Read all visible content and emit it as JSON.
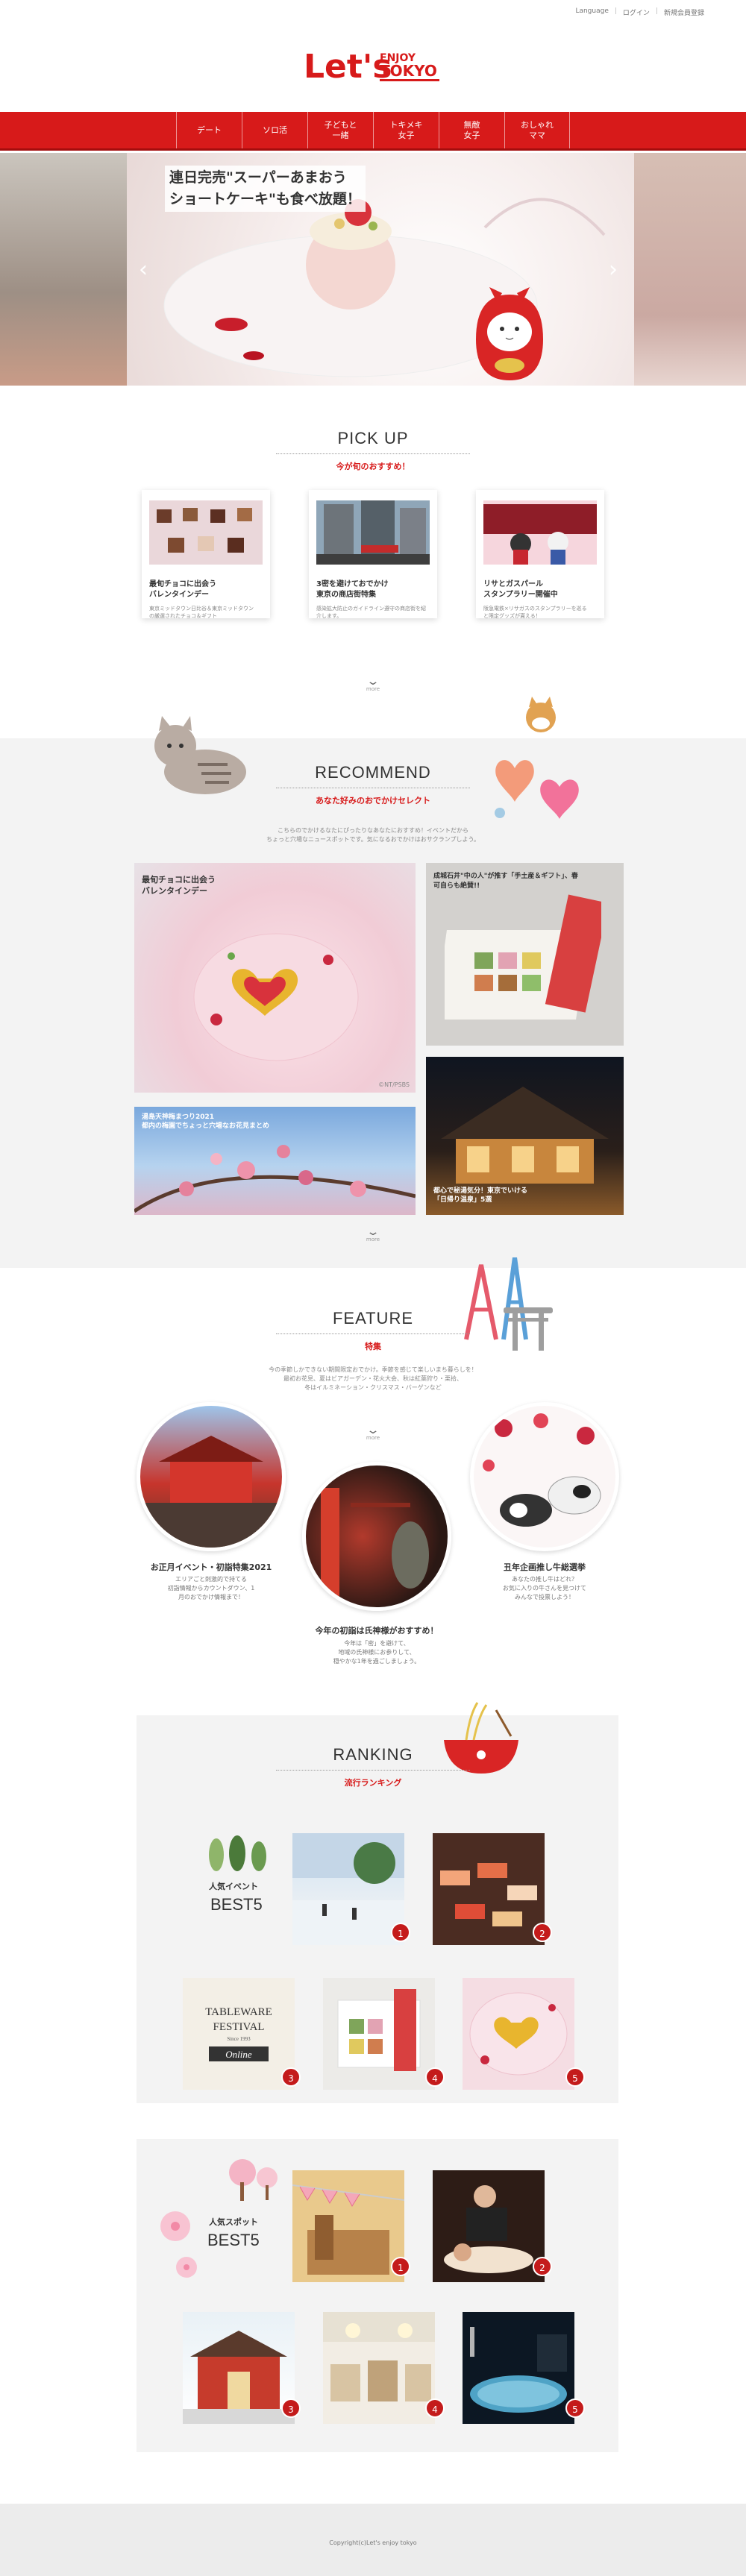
{
  "header": {
    "links": [
      "Language",
      "ログイン",
      "新規会員登録"
    ],
    "logo_main": "Let's",
    "logo_sub1": "ENJOY",
    "logo_sub2": "TOKYO"
  },
  "nav": {
    "items": [
      "デート",
      "ソロ活",
      "子どもと\n一緒",
      "トキメキ\n女子",
      "無敵\n女子",
      "おしゃれ\nママ"
    ]
  },
  "hero": {
    "caption_line1": "連日完売\"スーパーあまおう",
    "caption_line2": "ショートケーキ\"も食べ放題！",
    "prev": "‹",
    "next": "›"
  },
  "pickup": {
    "title_en": "PICK UP",
    "title_jp": "今が旬のおすすめ！",
    "cards": [
      {
        "title": "最旬チョコに出会う\nバレンタインデー",
        "desc": "東京ミッドタウン日比谷＆東京ミッドタウン\nの厳選されたチョコ＆ギフト"
      },
      {
        "title": "3密を避けておでかけ\n東京の商店街特集",
        "desc": "感染拡大防止のガイドライン遵守の商店街を紹\n介します。"
      },
      {
        "title": "リサとガスパール\nスタンプラリー開催中",
        "desc": "阪急電鉄×リサガスのスタンプラリーを巡る\nと限定グッズが貰える！"
      }
    ],
    "more": "more"
  },
  "recommend": {
    "title_en": "RECOMMEND",
    "title_jp": "あなた好みのおでかけセレクト",
    "intro_line1": "こちらのでかけるなたにぴったりなあなたにおすすめ！イベントだから",
    "intro_line2": "ちょっと穴場なニュースポットです。気になるおでかけはおサクランプしよう。",
    "tiles": [
      {
        "caption": "最旬チョコに出会う\nバレンタインデー",
        "credit": "©NT/PSBS"
      },
      {
        "caption": "成城石井\"中の人\"が推す「手土産＆ギフト」、春\n可自らも絶賛!!",
        "credit": ""
      },
      {
        "caption": "湯島天神梅まつり2021\n都内の梅園でちょっと穴場なお花見まとめ",
        "credit": ""
      },
      {
        "caption": "都心で秘湯気分！東京でいける\n「日帰り温泉」5選",
        "credit": ""
      }
    ],
    "more": "more"
  },
  "feature": {
    "title_en": "FEATURE",
    "title_jp": "特集",
    "intro_line1": "今の季節しかできない期間限定おでかけ。季節を感じて楽しいまち暮らしを！",
    "intro_line2": "最初お花見、夏はビアガーデン・花火大会、秋は紅葉狩り・栗拾、",
    "intro_line3": "冬はイルミネーション・クリスマス・バーゲンなど",
    "items": [
      {
        "title": "お正月イベント・初詣特集2021",
        "desc": "エリアごと刺激的で持てる\n初詣情報からカウントダウン、1\n月のおでかけ情報まで！"
      },
      {
        "title": "今年の初詣は氏神様がおすすめ！",
        "desc": "今年は「密」を避けて、\n地域の氏神様にお参りして、\n穏やかな1年を過ごしましょう。"
      },
      {
        "title": "丑年企画推し牛総選挙",
        "desc": "あなたの推し牛はどれ？\nお気に入りの牛さんを見つけて\nみんなで投票しよう！"
      }
    ],
    "more": "more"
  },
  "ranking": {
    "title_en": "RANKING",
    "title_jp": "流行ランキング",
    "events_label": "人気イベント",
    "events_best": "BEST5",
    "spots_label": "人気スポット",
    "spots_best": "BEST5",
    "event_ranks": [
      "1",
      "2",
      "3",
      "4",
      "5"
    ],
    "spot_ranks": [
      "1",
      "2",
      "3",
      "4",
      "5"
    ],
    "tableware_line1": "TABLEWARE",
    "tableware_line2": "FESTIVAL",
    "tableware_line3": "Since 1993",
    "tableware_line4": "Online"
  },
  "footer": {
    "copyright": "Copyright(c)Let's enjoy tokyo"
  },
  "colors": {
    "brand_red": "#d71a1a",
    "dark_red": "#a30d0d",
    "grey_bg": "#f3f3f3"
  }
}
